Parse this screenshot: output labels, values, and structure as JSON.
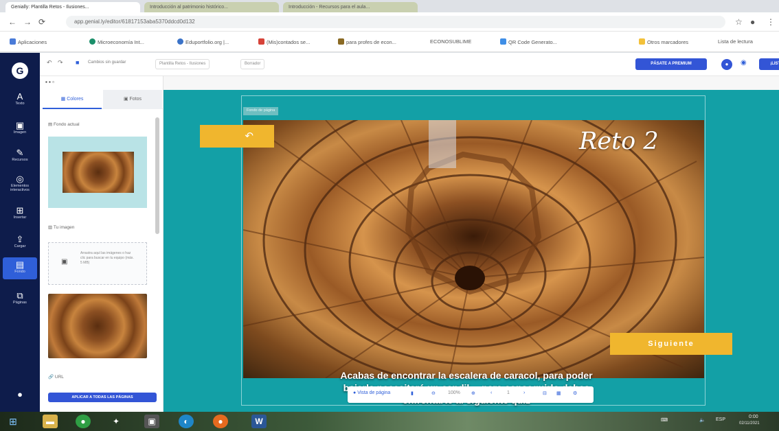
{
  "browser": {
    "tabs": [
      "Genially: Plantilla Retos - Ilusiones...",
      "Introducción al patrimonio histórico...",
      "Introducción - Recursos para el aula..."
    ],
    "url": "app.genial.ly/editor/61817153aba5370ddcd0d132",
    "bookmarks": [
      "Aplicaciones",
      "Microeconomía Int...",
      "Eduportfolio.org |...",
      "(Mis)contados se...",
      "para profes de econ...",
      "ECONOSUBLIME",
      "QR Code Generato...",
      "Otros marcadores",
      "Lista de lectura"
    ]
  },
  "rail": {
    "items": [
      "Texto",
      "Imagen",
      "Recursos",
      "Elementos interactivos",
      "Insertar",
      "Cargar",
      "Fondo",
      "Páginas"
    ]
  },
  "toolbar": {
    "save_status": "Cambios sin guardar",
    "template_name": "Plantilla Retos - Ilusiones",
    "draft_label": "Borrador",
    "premium_label": "PÁSATE A PREMIUM",
    "share_label": "¡LISTO!"
  },
  "panel": {
    "tab_colors": "Colores",
    "tab_photos": "Fotos",
    "section_bg": "Fondo actual",
    "section_uploads": "Tu imagen",
    "drop_text": "Arrastra aquí las imágenes o haz clic para buscar en tu equipo (máx. 5 MB)",
    "link_label": "URL",
    "apply_all": "APLICAR A TODAS LAS PÁGINAS"
  },
  "slide": {
    "chip": "Fondo de página",
    "title": "Reto 2",
    "body": "Acabas de encontrar la escalera de caracol, para poder bajarla necesitará un candil… para conseguirlo debes enfrentarte al siguiente quiz",
    "next_label": "Siguiente",
    "back_label": "↶"
  },
  "bottom": {
    "mode": "Vista de página",
    "zoom": "100%",
    "page_indicator": "1"
  },
  "taskbar": {
    "lang": "ESP",
    "time": "0:00",
    "date": "02/11/2021"
  }
}
